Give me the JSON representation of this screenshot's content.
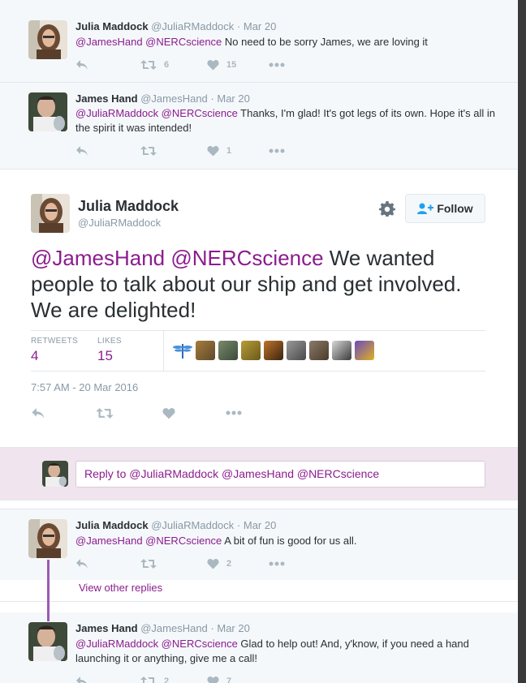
{
  "tweets_above": [
    {
      "name": "Julia Maddock",
      "handle": "@JuliaRMaddock",
      "date": "Mar 20",
      "mentions": "@JamesHand @NERCscience",
      "text": " No need to be sorry James, we are loving it",
      "retweets": "6",
      "likes": "15"
    },
    {
      "name": "James Hand",
      "handle": "@JamesHand",
      "date": "Mar 20",
      "mentions": "@JuliaRMaddock @NERCscience",
      "text": " Thanks, I'm glad! It's got legs of its own. Hope it's all in the spirit it was intended!",
      "retweets": "",
      "likes": "1"
    }
  ],
  "main_tweet": {
    "name": "Julia Maddock",
    "handle": "@JuliaRMaddock",
    "follow_label": "Follow",
    "mentions": "@JamesHand @NERCscience",
    "text": " We wanted people to talk about our ship and get involved. We are delighted!",
    "retweets_label": "RETWEETS",
    "retweets": "4",
    "likes_label": "LIKES",
    "likes": "15",
    "timestamp": "7:57 AM - 20 Mar 2016"
  },
  "reply_box": {
    "placeholder": "Reply to @JuliaRMaddock @JamesHand @NERCscience"
  },
  "replies": [
    {
      "name": "Julia Maddock",
      "handle": "@JuliaRMaddock",
      "date": "Mar 20",
      "mentions": "@JamesHand @NERCscience",
      "text": " A bit of fun is good for us all.",
      "retweets": "",
      "likes": "2"
    },
    {
      "name": "James Hand",
      "handle": "@JamesHand",
      "date": "Mar 20",
      "mentions": "@JuliaRMaddock @NERCscience",
      "text": " Glad to help out! And, y'know, if you need a hand launching it or anything, give me a call!",
      "retweets": "2",
      "likes": "7"
    }
  ],
  "view_other_replies": "View other replies",
  "colors": {
    "accent": "#8b1c8e",
    "muted": "#8899a6",
    "thread_line": "#9b59b6"
  },
  "icons": [
    "reply-icon",
    "retweet-icon",
    "heart-icon",
    "more-icon",
    "gear-icon",
    "follow-person-icon",
    "dragonfly-icon"
  ]
}
